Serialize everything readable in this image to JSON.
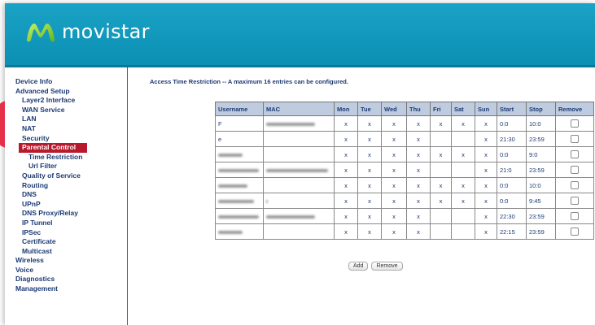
{
  "brand": {
    "name": "movistar"
  },
  "sidebar": {
    "items": [
      {
        "label": "Device Info",
        "level": 1
      },
      {
        "label": "Advanced Setup",
        "level": 1
      },
      {
        "label": "Layer2 Interface",
        "level": 2
      },
      {
        "label": "WAN Service",
        "level": 2
      },
      {
        "label": "LAN",
        "level": 2
      },
      {
        "label": "NAT",
        "level": 2
      },
      {
        "label": "Security",
        "level": 2
      },
      {
        "label": "Parental Control",
        "level": 2,
        "active": true
      },
      {
        "label": "Time Restriction",
        "level": 3
      },
      {
        "label": "Url Filter",
        "level": 3
      },
      {
        "label": "Quality of Service",
        "level": 2
      },
      {
        "label": "Routing",
        "level": 2
      },
      {
        "label": "DNS",
        "level": 2
      },
      {
        "label": "UPnP",
        "level": 2
      },
      {
        "label": "DNS Proxy/Relay",
        "level": 2
      },
      {
        "label": "IP Tunnel",
        "level": 2
      },
      {
        "label": "IPSec",
        "level": 2
      },
      {
        "label": "Certificate",
        "level": 2
      },
      {
        "label": "Multicast",
        "level": 2
      },
      {
        "label": "Wireless",
        "level": 1
      },
      {
        "label": "Voice",
        "level": 1
      },
      {
        "label": "Diagnostics",
        "level": 1
      },
      {
        "label": "Management",
        "level": 1
      }
    ]
  },
  "main": {
    "title": "Access Time Restriction -- A maximum 16 entries can be configured.",
    "table": {
      "headers": [
        "Username",
        "MAC",
        "Mon",
        "Tue",
        "Wed",
        "Thu",
        "Fri",
        "Sat",
        "Sun",
        "Start",
        "Stop",
        "Remove"
      ],
      "rows": [
        {
          "username": "F",
          "mac": "",
          "days": [
            "x",
            "x",
            "x",
            "x",
            "x",
            "x",
            "x"
          ],
          "start": "0:0",
          "stop": "10:0"
        },
        {
          "username": "e",
          "mac": "",
          "days": [
            "x",
            "x",
            "x",
            "x",
            "",
            "",
            "x"
          ],
          "start": "21:30",
          "stop": "23:59"
        },
        {
          "username": "",
          "mac": "",
          "days": [
            "x",
            "x",
            "x",
            "x",
            "x",
            "x",
            "x"
          ],
          "start": "0:0",
          "stop": "9:0"
        },
        {
          "username": "",
          "mac": "",
          "days": [
            "x",
            "x",
            "x",
            "x",
            "",
            "",
            "x"
          ],
          "start": "21:0",
          "stop": "23:59"
        },
        {
          "username": "",
          "mac": "",
          "days": [
            "x",
            "x",
            "x",
            "x",
            "x",
            "x",
            "x"
          ],
          "start": "0:0",
          "stop": "10:0"
        },
        {
          "username": "",
          "mac": "",
          "days": [
            "x",
            "x",
            "x",
            "x",
            "x",
            "x",
            "x"
          ],
          "start": "0:0",
          "stop": "9:45"
        },
        {
          "username": "",
          "mac": "",
          "days": [
            "x",
            "x",
            "x",
            "x",
            "",
            "",
            "x"
          ],
          "start": "22:30",
          "stop": "23:59"
        },
        {
          "username": "",
          "mac": "",
          "days": [
            "x",
            "x",
            "x",
            "x",
            "",
            "",
            "x"
          ],
          "start": "22:15",
          "stop": "23:59"
        }
      ]
    },
    "buttons": {
      "add": "Add",
      "remove": "Remove"
    }
  }
}
